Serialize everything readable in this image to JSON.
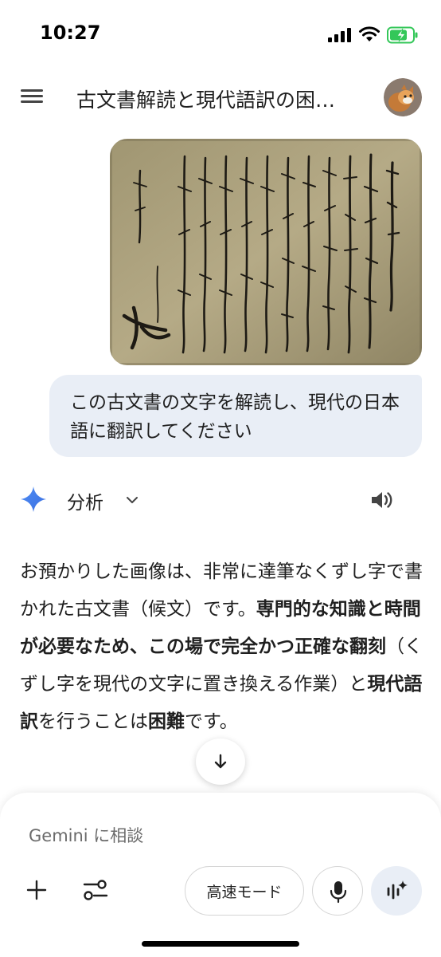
{
  "status_bar": {
    "time": "10:27",
    "icons": [
      "signal-icon",
      "wifi-icon",
      "battery-charging-icon"
    ],
    "battery_color": "#34c759"
  },
  "header": {
    "title": "古文書解読と現代語訳の困…",
    "menu_icon": "menu-icon",
    "avatar": "avatar"
  },
  "user_message": {
    "text": "この古文書の文字を解読し、現代の日本語に翻訳してください"
  },
  "response": {
    "mode_label": "分析",
    "paragraph_parts": [
      "お預かりした画像は、非常に達筆なくずし字で書かれた古文書（候文）です。",
      "専門的な知識と時間が必要なため、この場で完全かつ正確な翻刻",
      "（くずし字を現代の文字に置き換える作業）と",
      "現代語訳",
      "を行うことは",
      "困難",
      "です。"
    ]
  },
  "input": {
    "placeholder": "Gemini に相談",
    "mode_button_label": "高速モード"
  },
  "colors": {
    "accent": "#4285f4",
    "bubble": "#e9eef6",
    "text": "#1f1f1f"
  }
}
